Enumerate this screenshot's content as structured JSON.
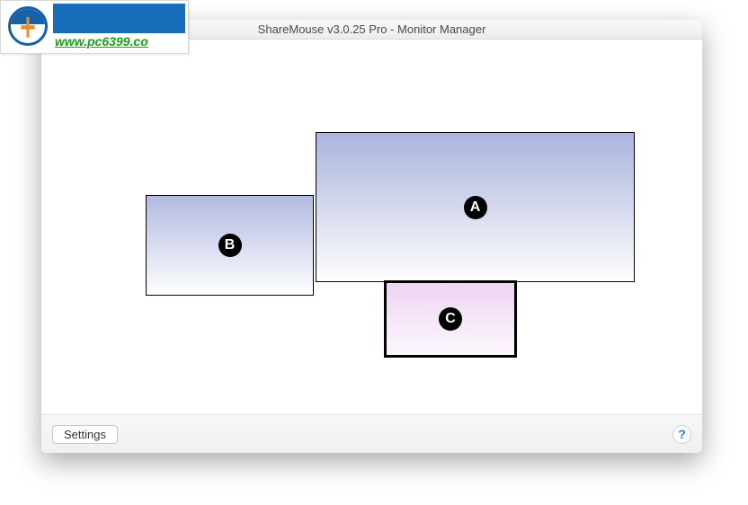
{
  "window": {
    "title": "ShareMouse v3.0.25 Pro - Monitor Manager"
  },
  "monitors": {
    "a": {
      "label": "A"
    },
    "b": {
      "label": "B"
    },
    "c": {
      "label": "C"
    }
  },
  "bottombar": {
    "settings_label": "Settings",
    "help_symbol": "?"
  },
  "watermark": {
    "url_text": "www.pc6399.co"
  }
}
